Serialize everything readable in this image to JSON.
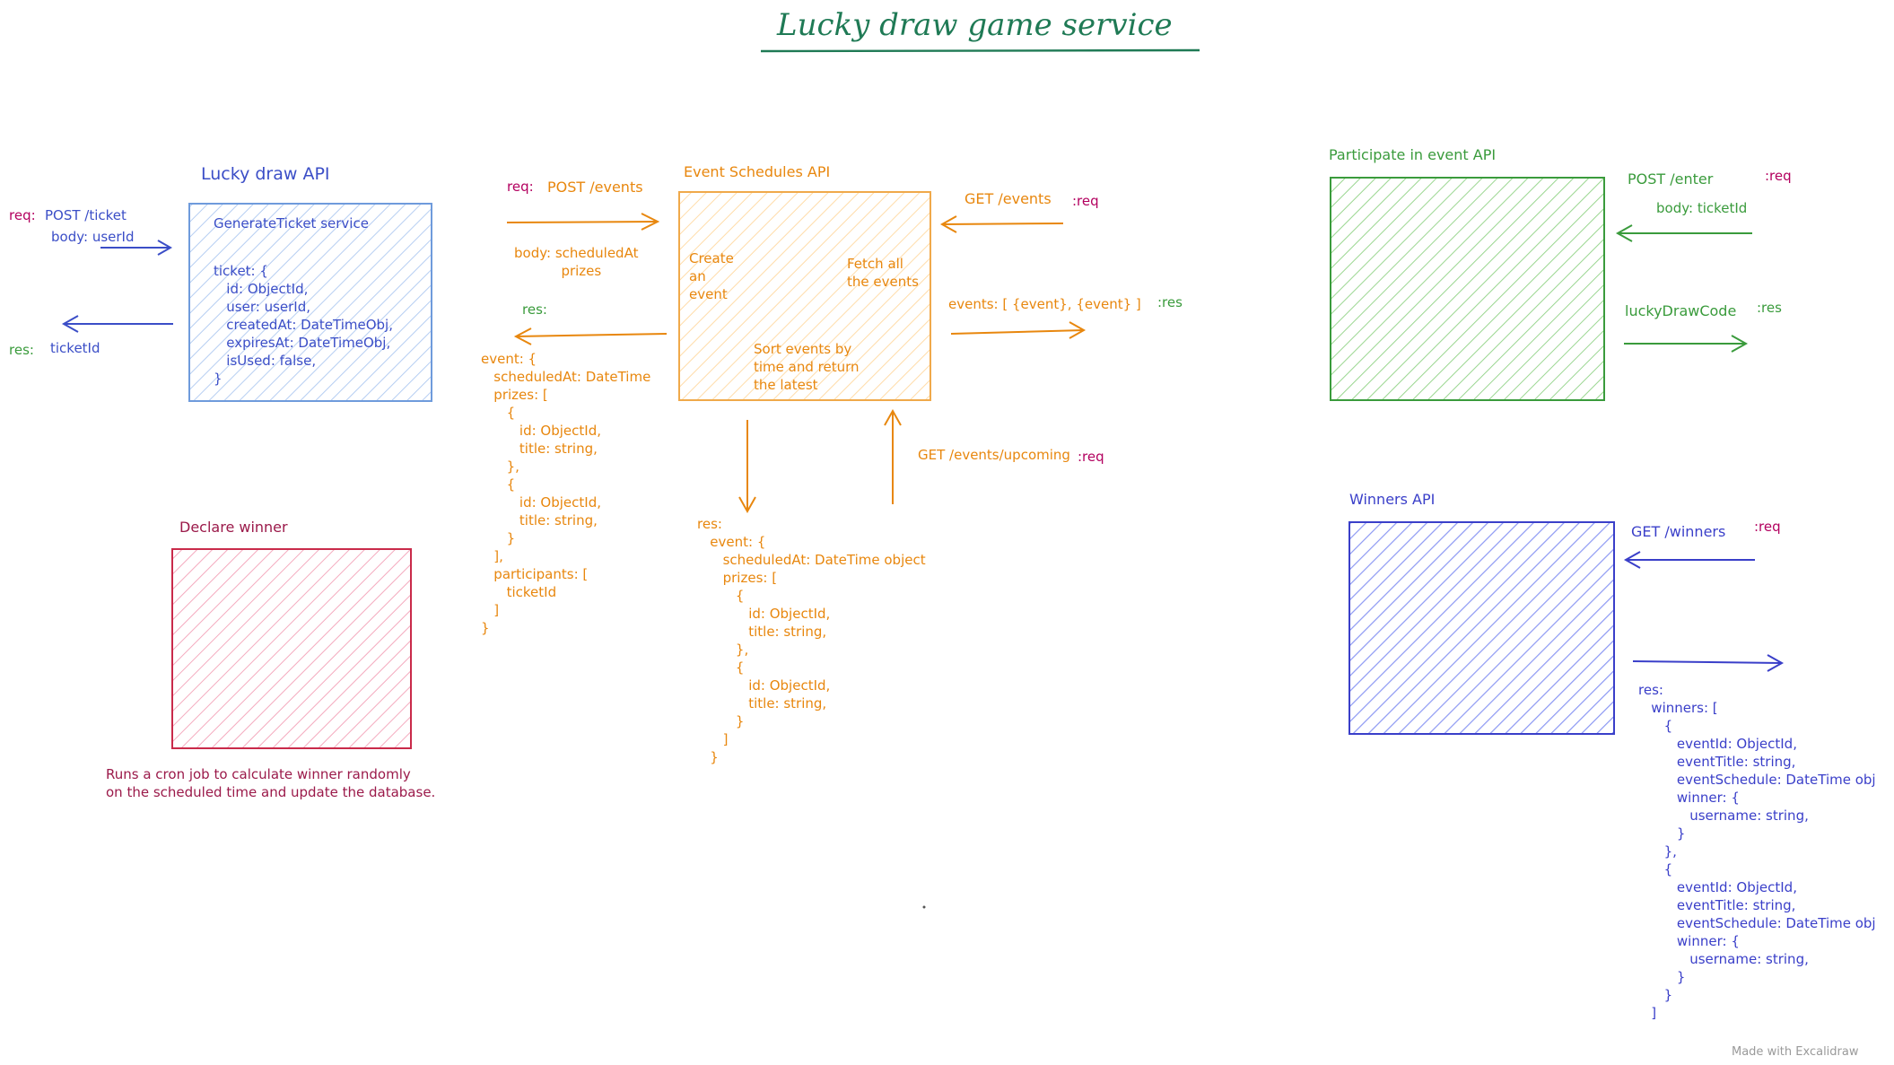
{
  "title": "Lucky draw game service",
  "footer": "Made with Excalidraw",
  "colors": {
    "blue": "#3b4ec7",
    "orange": "#e8870e",
    "green": "#3a9b3c",
    "red": "#c92a4a",
    "purple": "#3a3fc9",
    "maroon": "#b3005f"
  },
  "lucky_draw": {
    "heading": "Lucky draw API",
    "req_tag": "req:",
    "req_route": "POST /ticket",
    "req_body": "body: userId",
    "res_tag": "res:",
    "res_value": "ticketId",
    "box_title": "GenerateTicket service",
    "box_code": "ticket: {\n   id: ObjectId,\n   user: userId,\n   createdAt: DateTimeObj,\n   expiresAt: DateTimeObj,\n   isUsed: false,\n}"
  },
  "event_schedules": {
    "heading": "Event Schedules API",
    "req_tag": "req:",
    "req_route": "POST /events",
    "req_body": "body: scheduledAt\n           prizes",
    "res_tag": "res:",
    "res_code": "event: {\n   scheduledAt: DateTime\n   prizes: [\n      {\n         id: ObjectId,\n         title: string,\n      },\n      {\n         id: ObjectId,\n         title: string,\n      }\n   ],\n   participants: [\n      ticketId\n   ]\n}",
    "box_create": "Create\nan\nevent",
    "box_fetch": "Fetch all\nthe events",
    "box_sort": "Sort events by\ntime and return\nthe latest",
    "get_events": "GET /events",
    "get_events_tag": ":req",
    "events_res": "events: [ {event}, {event} ]",
    "events_res_tag": ":res",
    "get_upcoming": "GET /events/upcoming",
    "get_upcoming_tag": ":req",
    "upcoming_res_code": "res:\n   event: {\n      scheduledAt: DateTime object\n      prizes: [\n         {\n            id: ObjectId,\n            title: string,\n         },\n         {\n            id: ObjectId,\n            title: string,\n         }\n      ]\n   }"
  },
  "participate": {
    "heading": "Participate in event API",
    "req_route": "POST /enter",
    "req_tag": ":req",
    "req_body": "body: ticketId",
    "res_value": "luckyDrawCode",
    "res_tag": ":res"
  },
  "declare": {
    "heading": "Declare winner",
    "note": "Runs a cron job to calculate winner randomly\non the scheduled time and update the database."
  },
  "winners": {
    "heading": "Winners API",
    "req_route": "GET /winners",
    "req_tag": ":req",
    "res_code": "res:\n   winners: [\n      {\n         eventId: ObjectId,\n         eventTitle: string,\n         eventSchedule: DateTime obj\n         winner: {\n            username: string,\n         }\n      },\n      {\n         eventId: ObjectId,\n         eventTitle: string,\n         eventSchedule: DateTime obj\n         winner: {\n            username: string,\n         }\n      }\n   ]"
  }
}
